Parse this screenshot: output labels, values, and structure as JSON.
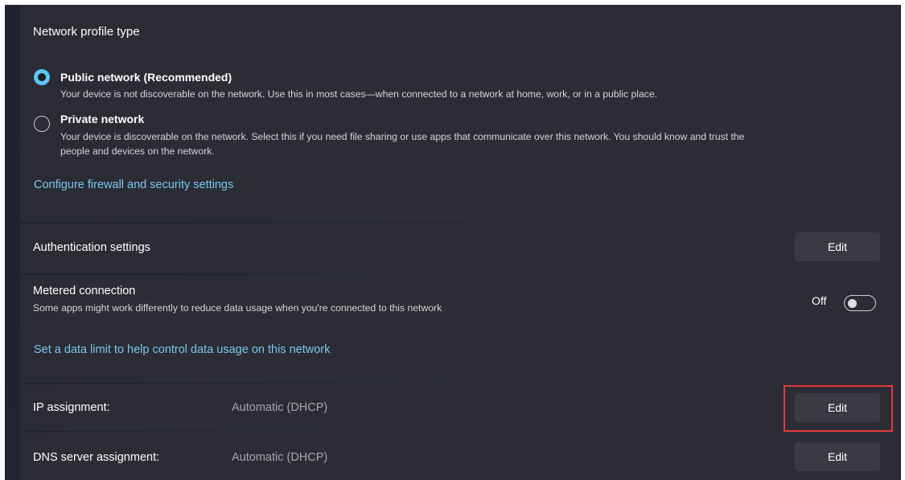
{
  "profile": {
    "title": "Network profile type",
    "options": [
      {
        "label": "Public network (Recommended)",
        "description": "Your device is not discoverable on the network. Use this in most cases—when connected to a network at home, work, or in a public place.",
        "selected": true
      },
      {
        "label": "Private network",
        "description_line1": "Your device is discoverable on the network. Select this if you need file sharing or use apps that communicate over this network. You should know and trust the",
        "description_line2": "people and devices on the network.",
        "selected": false
      }
    ],
    "firewall_link": "Configure firewall and security settings"
  },
  "auth": {
    "label": "Authentication settings",
    "button": "Edit"
  },
  "metered": {
    "title": "Metered connection",
    "description": "Some apps might work differently to reduce data usage when you're connected to this network",
    "toggle_state": "Off",
    "toggle_on": false,
    "data_limit_link": "Set a data limit to help control data usage on this network"
  },
  "ip": {
    "label": "IP assignment:",
    "value": "Automatic (DHCP)",
    "button": "Edit"
  },
  "dns": {
    "label": "DNS server assignment:",
    "value": "Automatic (DHCP)",
    "button": "Edit"
  },
  "colors": {
    "accent": "#5bc6f7",
    "link": "#78c8f0",
    "highlight": "#e23a3a"
  }
}
